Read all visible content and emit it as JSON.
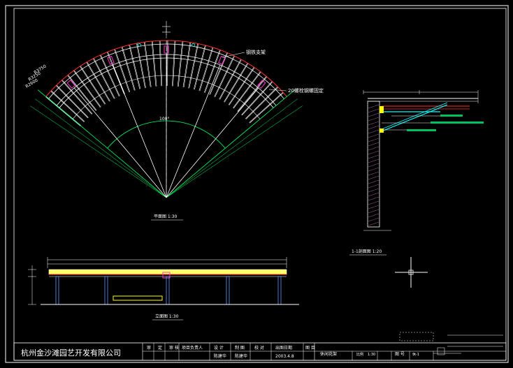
{
  "plan": {
    "label_steel_support": "钢铁支架",
    "label_bolt": "20螺栓钢螺固定",
    "label_radius_outer": "R3750",
    "label_radius_mid": "R3250",
    "label_radius_inner": "R2600",
    "label_angle": "100°",
    "caption": "平面图 1:30"
  },
  "elevation": {
    "caption": "立面图 1:30"
  },
  "section": {
    "caption": "1-1剖面图 1:20"
  },
  "title_block": {
    "company": "杭州金沙滩园艺开发有限公司",
    "headers": [
      "审",
      "定",
      "审 核",
      "项目负责人",
      "设 计",
      "制 图",
      "校 对",
      "出图日期",
      "图 目",
      "休闲花架",
      "比例",
      "1:30",
      "图 号",
      "休-1"
    ],
    "values": [
      "陈建华",
      "陈建华",
      "2003.4.8"
    ]
  }
}
